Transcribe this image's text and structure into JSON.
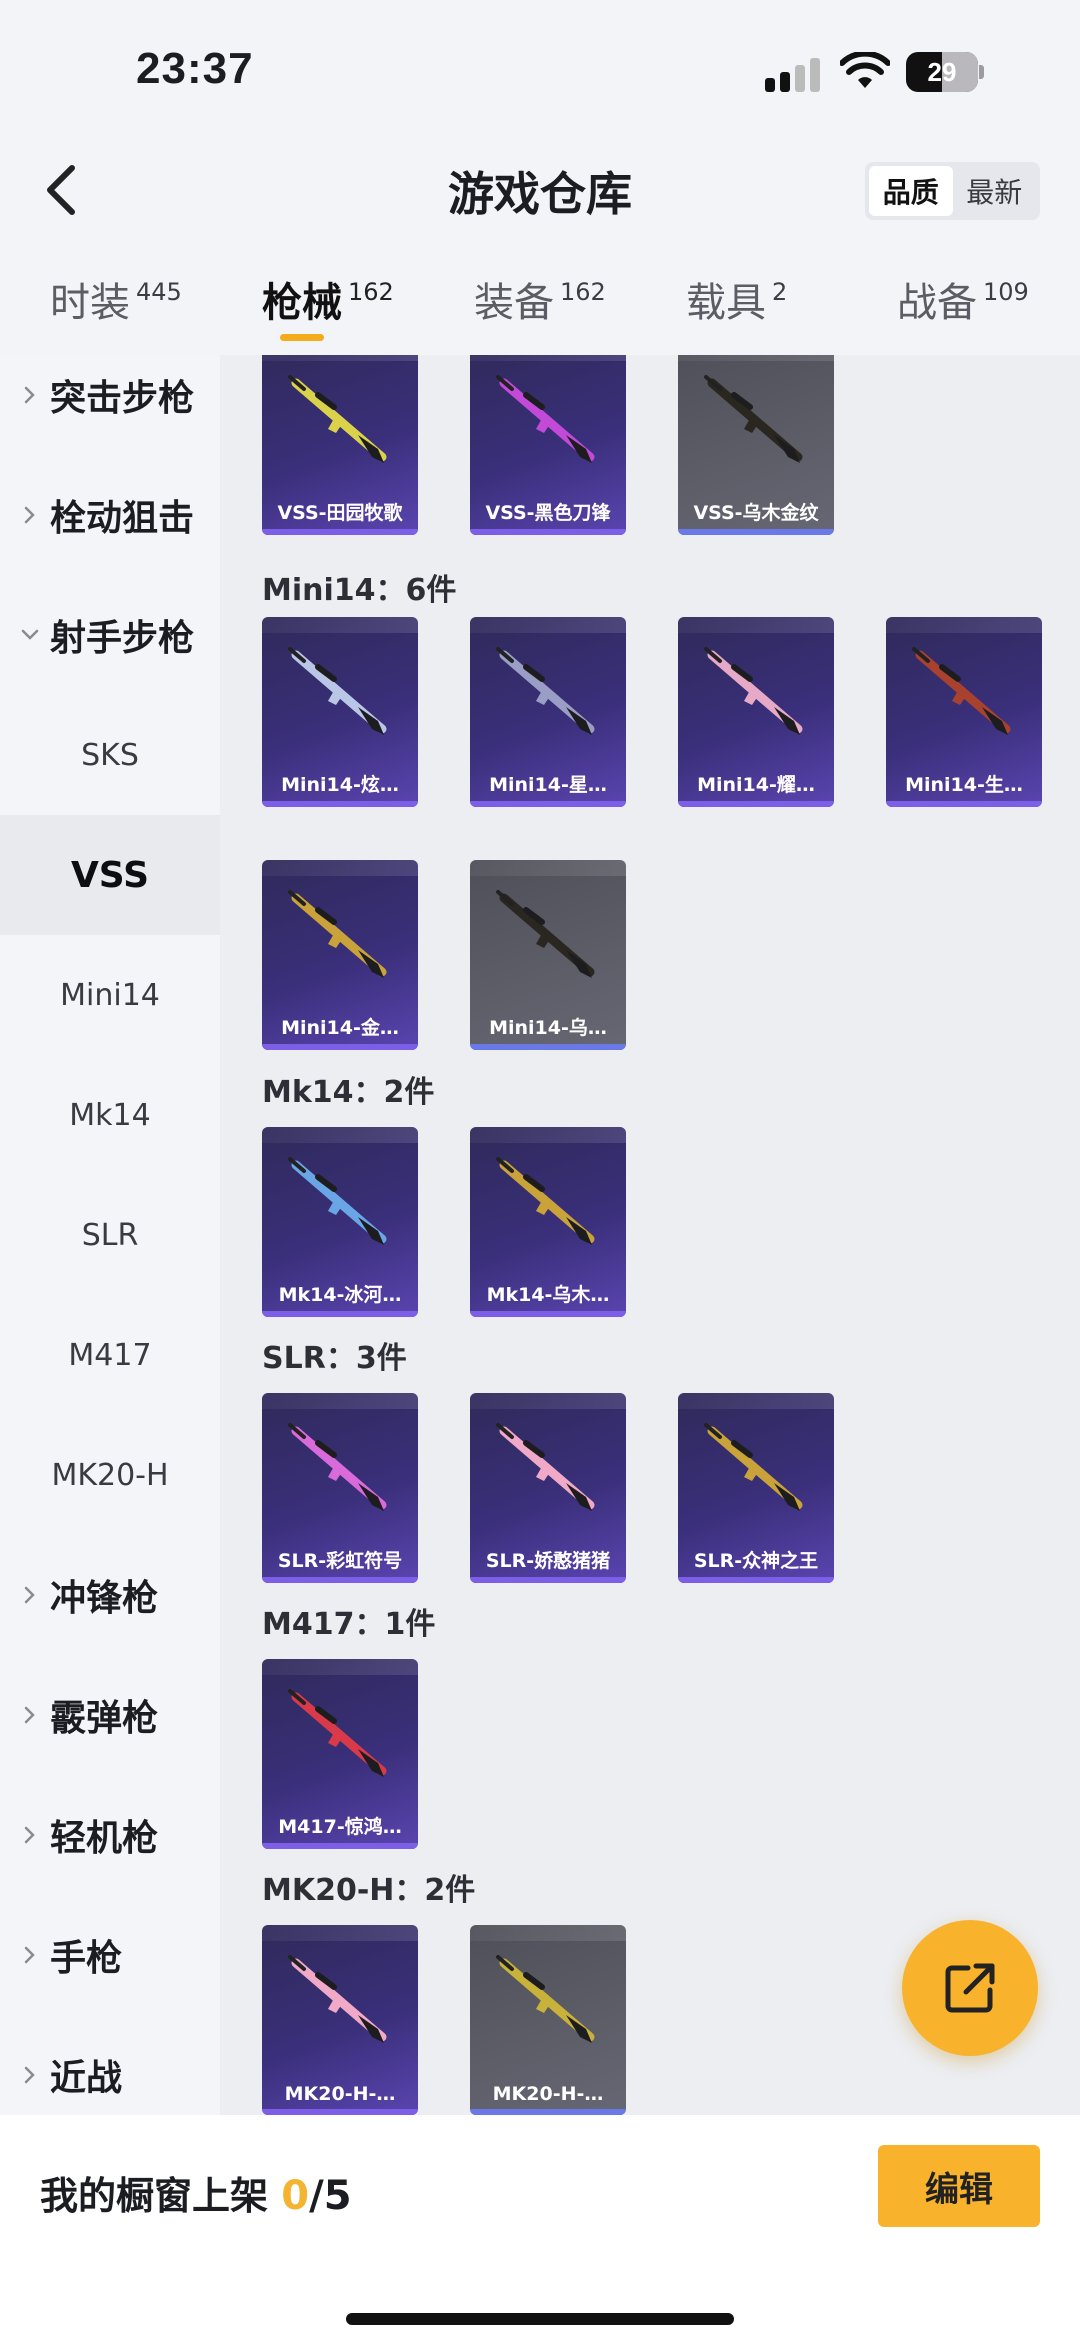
{
  "status": {
    "time": "23:37",
    "battery": "29"
  },
  "header": {
    "title": "游戏仓库",
    "sort_options": [
      "品质",
      "最新"
    ],
    "sort_active": 0
  },
  "tabs": [
    {
      "label": "时装",
      "count": "445"
    },
    {
      "label": "枪械",
      "count": "162"
    },
    {
      "label": "装备",
      "count": "162"
    },
    {
      "label": "载具",
      "count": "2"
    },
    {
      "label": "战备",
      "count": "109"
    }
  ],
  "sidebar": {
    "items": [
      {
        "label": "突击步枪",
        "type": "category"
      },
      {
        "label": "栓动狙击",
        "type": "category"
      },
      {
        "label": "射手步枪",
        "type": "category-open"
      },
      {
        "label": "SKS",
        "type": "sub"
      },
      {
        "label": "VSS",
        "type": "sub-selected"
      },
      {
        "label": "Mini14",
        "type": "sub"
      },
      {
        "label": "Mk14",
        "type": "sub"
      },
      {
        "label": "SLR",
        "type": "sub"
      },
      {
        "label": "M417",
        "type": "sub"
      },
      {
        "label": "MK20-H",
        "type": "sub"
      },
      {
        "label": "冲锋枪",
        "type": "category"
      },
      {
        "label": "霰弹枪",
        "type": "category"
      },
      {
        "label": "轻机枪",
        "type": "category"
      },
      {
        "label": "手枪",
        "type": "category"
      },
      {
        "label": "近战",
        "type": "category"
      }
    ]
  },
  "groups": [
    {
      "title": "",
      "items": [
        {
          "name": "VSS-田园牧歌",
          "style": "purple",
          "gun_color": "#d9d24a"
        },
        {
          "name": "VSS-黑色刀锋",
          "style": "purple",
          "gun_color": "#c34ad9"
        },
        {
          "name": "VSS-乌木金纹",
          "style": "gray",
          "gun_color": "#2a2620"
        }
      ]
    },
    {
      "title": "Mini14：6件",
      "items": [
        {
          "name": "Mini14-炫…",
          "style": "purple",
          "gun_color": "#b9c6e6"
        },
        {
          "name": "Mini14-星…",
          "style": "purple",
          "gun_color": "#9a9ec6"
        },
        {
          "name": "Mini14-耀…",
          "style": "purple",
          "gun_color": "#e6a9c6"
        },
        {
          "name": "Mini14-生…",
          "style": "purple",
          "gun_color": "#a8422e"
        },
        {
          "name": "Mini14-金…",
          "style": "purple",
          "gun_color": "#c9a23a"
        },
        {
          "name": "Mini14-乌…",
          "style": "gray",
          "gun_color": "#2a2620"
        }
      ]
    },
    {
      "title": "Mk14：2件",
      "items": [
        {
          "name": "Mk14-冰河…",
          "style": "purple",
          "gun_color": "#6aa6e6"
        },
        {
          "name": "Mk14-乌木…",
          "style": "purple",
          "gun_color": "#c9a23a"
        }
      ]
    },
    {
      "title": "SLR：3件",
      "items": [
        {
          "name": "SLR-彩虹符号",
          "style": "purple",
          "gun_color": "#d96ad9"
        },
        {
          "name": "SLR-娇憨猪猪",
          "style": "purple",
          "gun_color": "#f0a9c6"
        },
        {
          "name": "SLR-众神之王",
          "style": "purple",
          "gun_color": "#c9a23a"
        }
      ]
    },
    {
      "title": "M417：1件",
      "items": [
        {
          "name": "M417-惊鸿…",
          "style": "purple",
          "gun_color": "#d93a4a"
        }
      ]
    },
    {
      "title": "MK20-H：2件",
      "items": [
        {
          "name": "MK20-H-…",
          "style": "purple",
          "gun_color": "#f0a9c6"
        },
        {
          "name": "MK20-H-…",
          "style": "gray",
          "gun_color": "#c9b23a"
        }
      ]
    }
  ],
  "bottom": {
    "shelf_label": "我的橱窗上架",
    "current": "0",
    "total": "/5",
    "edit_label": "编辑"
  }
}
